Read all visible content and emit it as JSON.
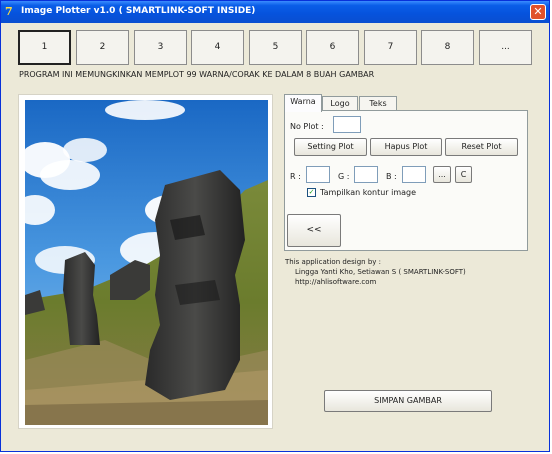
{
  "window": {
    "title": "Image Plotter v1.0 ( SMARTLINK-SOFT INSIDE)",
    "close_label": "✕",
    "app_icon_glyph": "7"
  },
  "buttons": [
    "1",
    "2",
    "3",
    "4",
    "5",
    "6",
    "7",
    "8",
    "..."
  ],
  "info": "PROGRAM INI MEMUNGKINKAN MEMPLOT 99 WARNA/CORAK KE DALAM 8 BUAH GAMBAR",
  "tabs": [
    "Warna",
    "Logo",
    "Teks"
  ],
  "warna": {
    "no_plot_label": "No Plot :",
    "no_plot_value": "",
    "setting_plot": "Setting Plot",
    "hapus_plot": "Hapus Plot",
    "reset_plot": "Reset Plot",
    "r_label": "R :",
    "g_label": "G :",
    "b_label": "B :",
    "r_value": "",
    "g_value": "",
    "b_value": "",
    "ellipsis_btn": "...",
    "c_btn": "C",
    "checkbox_label": "Tampilkan kontur image",
    "checkbox_checked": true,
    "back_btn": "<<"
  },
  "credits": {
    "line1": "This application design by :",
    "line2": "Lingga Yanti Kho, Setiawan S ( SMARTLINK-SOFT)",
    "line3": "http://ahlisoftware.com"
  },
  "save_button": "SIMPAN GAMBAR",
  "colors": {
    "title_bar": "#0a5ee8",
    "window_bg": "#ece9d8",
    "close_btn": "#e0512b"
  }
}
